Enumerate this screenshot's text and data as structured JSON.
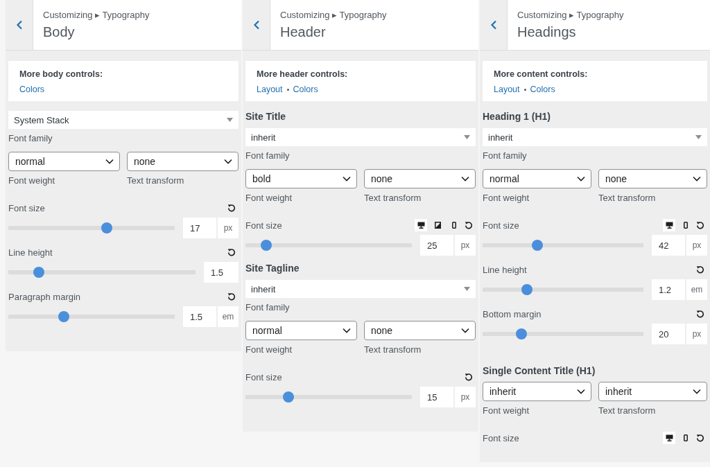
{
  "panels": [
    {
      "breadcrumb": "Customizing ▸ Typography",
      "title": "Body",
      "more": {
        "label": "More body controls:",
        "links": [
          "Colors"
        ]
      },
      "controls": [
        {
          "kind": "family",
          "value": "System Stack",
          "label": "Font family"
        },
        {
          "kind": "pair",
          "selects": [
            {
              "value": "normal",
              "label": "Font weight"
            },
            {
              "value": "none",
              "label": "Text transform"
            }
          ]
        },
        {
          "kind": "slider",
          "label": "Font size",
          "level": 0.6,
          "value": "17",
          "unit": "px"
        },
        {
          "kind": "slider",
          "label": "Line height",
          "level": 0.14,
          "value": "1.5"
        },
        {
          "kind": "slider",
          "label": "Paragraph margin",
          "level": 0.32,
          "value": "1.5",
          "unit": "em"
        }
      ]
    },
    {
      "breadcrumb": "Customizing ▸ Typography",
      "title": "Header",
      "more": {
        "label": "More header controls:",
        "links": [
          "Layout",
          "Colors"
        ]
      },
      "controls": [
        {
          "kind": "heading",
          "text": "Site Title"
        },
        {
          "kind": "family",
          "value": "inherit",
          "label": "Font family"
        },
        {
          "kind": "pair",
          "selects": [
            {
              "value": "bold",
              "label": "Font weight"
            },
            {
              "value": "none",
              "label": "Text transform"
            }
          ]
        },
        {
          "kind": "slider",
          "label": "Font size",
          "devices": [
            {
              "kind": "desktop",
              "selected": true
            },
            {
              "kind": "tablet",
              "selected": false
            },
            {
              "kind": "mobile",
              "selected": false
            }
          ],
          "level": 0.1,
          "value": "25",
          "unit": "px"
        },
        {
          "kind": "heading",
          "text": "Site Tagline"
        },
        {
          "kind": "family",
          "value": "inherit",
          "label": "Font family"
        },
        {
          "kind": "pair",
          "selects": [
            {
              "value": "normal",
              "label": "Font weight"
            },
            {
              "value": "none",
              "label": "Text transform"
            }
          ]
        },
        {
          "kind": "slider",
          "label": "Font size",
          "level": 0.24,
          "value": "15",
          "unit": "px"
        }
      ]
    },
    {
      "breadcrumb": "Customizing ▸ Typography",
      "title": "Headings",
      "more": {
        "label": "More content controls:",
        "links": [
          "Layout",
          "Colors"
        ]
      },
      "controls": [
        {
          "kind": "heading",
          "text": "Heading 1 (H1)"
        },
        {
          "kind": "family",
          "value": "inherit",
          "label": "Font family"
        },
        {
          "kind": "pair",
          "selects": [
            {
              "value": "normal",
              "label": "Font weight"
            },
            {
              "value": "none",
              "label": "Text transform"
            }
          ]
        },
        {
          "kind": "slider",
          "label": "Font size",
          "devices": [
            {
              "kind": "desktop",
              "selected": true
            },
            {
              "kind": "mobile",
              "selected": false
            }
          ],
          "level": 0.33,
          "value": "42",
          "unit": "px"
        },
        {
          "kind": "slider",
          "label": "Line height",
          "level": 0.26,
          "value": "1.2",
          "unit": "em"
        },
        {
          "kind": "slider",
          "label": "Bottom margin",
          "level": 0.22,
          "value": "20",
          "unit": "px"
        },
        {
          "kind": "heading",
          "text": "Single Content Title (H1)",
          "spaced": true
        },
        {
          "kind": "pair",
          "selects": [
            {
              "value": "inherit",
              "label": "Font weight"
            },
            {
              "value": "inherit",
              "label": "Text transform"
            }
          ]
        },
        {
          "kind": "label",
          "label": "Font size",
          "devices": [
            {
              "kind": "desktop",
              "selected": true
            },
            {
              "kind": "mobile",
              "selected": false
            }
          ]
        }
      ]
    }
  ]
}
